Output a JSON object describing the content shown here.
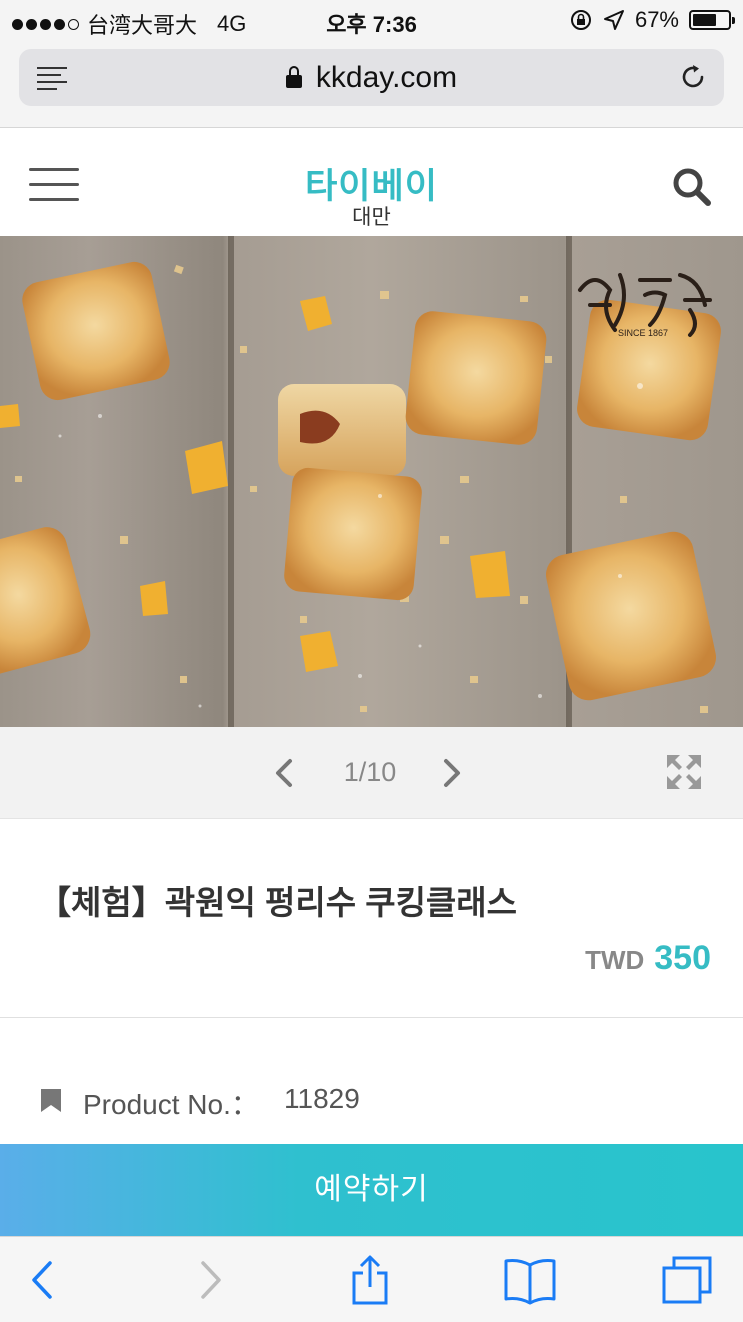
{
  "status_bar": {
    "carrier": "台湾大哥大",
    "network": "4G",
    "time": "오후 7:36",
    "battery": "67%",
    "battery_level": 0.67
  },
  "browser": {
    "url": "kkday.com"
  },
  "header": {
    "title": "타이베이",
    "subtitle": "대만"
  },
  "carousel": {
    "counter": "1/10"
  },
  "product": {
    "title": "【체험】곽원익 펑리수 쿠킹클래스",
    "currency": "TWD",
    "price": "350",
    "product_no_label": "Product No.：",
    "product_no": "11829"
  },
  "book_button": {
    "label": "예약하기"
  },
  "colors": {
    "accent": "#36bcc4",
    "button_start": "#5aaee9",
    "button_end": "#28c4cc",
    "ios_blue": "#1a7cf5"
  },
  "icons": {
    "status": [
      "signal-icon",
      "orientation-lock-icon",
      "location-icon",
      "battery-icon"
    ],
    "browser": [
      "reader-menu-icon",
      "lock-icon",
      "reload-icon"
    ],
    "header": [
      "hamburger-menu-icon",
      "search-icon"
    ],
    "carousel": [
      "chevron-left-icon",
      "chevron-right-icon",
      "expand-icon"
    ],
    "meta": [
      "bookmark-icon"
    ],
    "toolbar": [
      "back-icon",
      "forward-icon",
      "share-icon",
      "bookmarks-icon",
      "tabs-icon"
    ]
  }
}
